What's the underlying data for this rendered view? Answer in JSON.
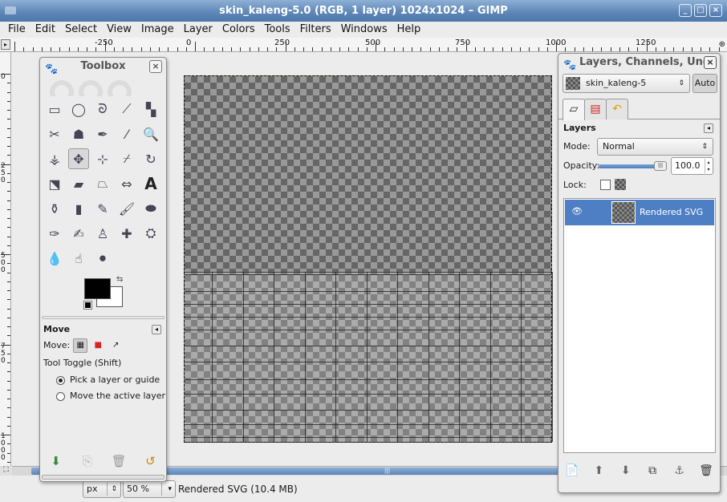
{
  "window": {
    "title": "skin_kaleng-5.0 (RGB, 1 layer) 1024x1024 – GIMP",
    "buttons": [
      "_",
      "□",
      "×"
    ]
  },
  "menu": [
    "File",
    "Edit",
    "Select",
    "View",
    "Image",
    "Layer",
    "Colors",
    "Tools",
    "Filters",
    "Windows",
    "Help"
  ],
  "ruler_top": {
    "labels": [
      "-250",
      "0",
      "250",
      "500",
      "750",
      "1000",
      "1250"
    ]
  },
  "ruler_left": {
    "labels": [
      "0",
      "250",
      "500",
      "750",
      "1000"
    ]
  },
  "toolbox": {
    "title": "Toolbox",
    "close": "×",
    "tools": [
      {
        "icon": "rect-select-icon",
        "glyph": "▭"
      },
      {
        "icon": "ellipse-select-icon",
        "glyph": "◯"
      },
      {
        "icon": "free-select-icon",
        "glyph": "ᘐ"
      },
      {
        "icon": "fuzzy-select-icon",
        "glyph": "⟋"
      },
      {
        "icon": "color-select-icon",
        "glyph": "▚"
      },
      {
        "icon": "scissors-icon",
        "glyph": "✂"
      },
      {
        "icon": "foreground-select-icon",
        "glyph": "☗"
      },
      {
        "icon": "paths-icon",
        "glyph": "✒"
      },
      {
        "icon": "color-picker-icon",
        "glyph": "⁄"
      },
      {
        "icon": "zoom-icon",
        "glyph": "🔍"
      },
      {
        "icon": "measure-icon",
        "glyph": "⚶"
      },
      {
        "icon": "move-icon",
        "glyph": "✥"
      },
      {
        "icon": "align-icon",
        "glyph": "⊹"
      },
      {
        "icon": "crop-icon",
        "glyph": "⌿"
      },
      {
        "icon": "rotate-icon",
        "glyph": "↻"
      },
      {
        "icon": "scale-icon",
        "glyph": "⬔"
      },
      {
        "icon": "shear-icon",
        "glyph": "▰"
      },
      {
        "icon": "perspective-icon",
        "glyph": "⏢"
      },
      {
        "icon": "flip-icon",
        "glyph": "⇔"
      },
      {
        "icon": "text-icon",
        "glyph": "A"
      },
      {
        "icon": "bucket-fill-icon",
        "glyph": "⚱"
      },
      {
        "icon": "blend-icon",
        "glyph": "▮"
      },
      {
        "icon": "pencil-icon",
        "glyph": "✎"
      },
      {
        "icon": "paintbrush-icon",
        "glyph": "🖌"
      },
      {
        "icon": "eraser-icon",
        "glyph": "⬬"
      },
      {
        "icon": "airbrush-icon",
        "glyph": "✑"
      },
      {
        "icon": "ink-icon",
        "glyph": "✍"
      },
      {
        "icon": "clone-icon",
        "glyph": "♙"
      },
      {
        "icon": "heal-icon",
        "glyph": "✚"
      },
      {
        "icon": "perspective-clone-icon",
        "glyph": "⛭"
      },
      {
        "icon": "blur-icon",
        "glyph": "💧"
      },
      {
        "icon": "smudge-icon",
        "glyph": "☝"
      },
      {
        "icon": "dodge-burn-icon",
        "glyph": "⚫"
      }
    ],
    "fg_color": "#000000",
    "bg_color": "#ffffff",
    "options": {
      "title": "Move",
      "move_label": "Move:",
      "toggle_label": "Tool Toggle  (Shift)",
      "radio_pick": "Pick a layer or guide",
      "radio_move": "Move the active layer"
    }
  },
  "status": {
    "unit": "px",
    "zoom": "50 %",
    "text": "Rendered SVG (10.4 MB)"
  },
  "layers_dock": {
    "title": "Layers, Channels, Und",
    "image_name": "skin_kaleng-5",
    "auto_label": "Auto",
    "panel_title": "Layers",
    "mode_label": "Mode:",
    "mode_value": "Normal",
    "opacity_label": "Opacity:",
    "opacity_value": "100.0",
    "opacity_fraction": 1.0,
    "lock_label": "Lock:",
    "layers": [
      {
        "name": "Rendered SVG"
      }
    ]
  },
  "colors": {
    "title_bar": "#5f87b8",
    "selection": "#4e7fc4",
    "canvas_bg": "#ececec"
  }
}
